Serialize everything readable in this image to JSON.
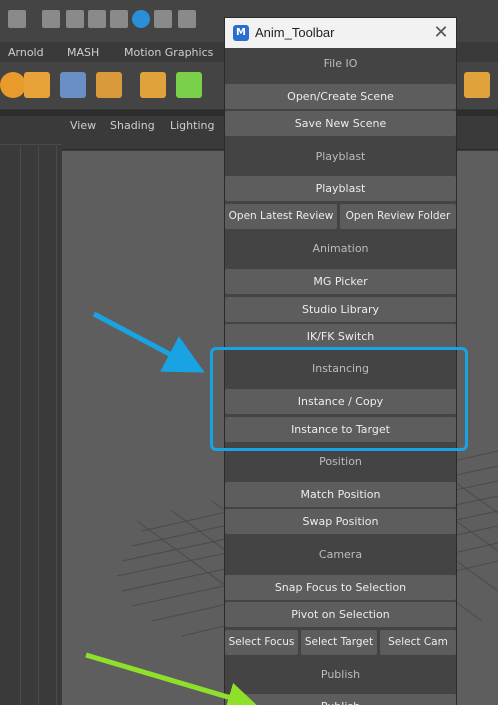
{
  "background": {
    "menubar": [
      "Arnold",
      "MASH",
      "Motion Graphics"
    ],
    "viewport_menu": [
      "View",
      "Shading",
      "Lighting"
    ]
  },
  "window": {
    "title": "Anim_Toolbar",
    "app_icon_letter": "M",
    "close_glyph": "✕",
    "sections": {
      "file_io": {
        "header": "File IO",
        "open_create": "Open/Create Scene",
        "save_new": "Save New Scene"
      },
      "playblast": {
        "header": "Playblast",
        "playblast": "Playblast",
        "open_latest": "Open Latest Review",
        "open_folder": "Open Review Folder"
      },
      "animation": {
        "header": "Animation",
        "mg_picker": "MG Picker",
        "studio_library": "Studio Library",
        "ikfk": "IK/FK Switch"
      },
      "instancing": {
        "header": "Instancing",
        "instance_copy": "Instance / Copy",
        "instance_target": "Instance to Target"
      },
      "position": {
        "header": "Position",
        "match": "Match Position",
        "swap": "Swap Position"
      },
      "camera": {
        "header": "Camera",
        "snap_focus": "Snap Focus to Selection",
        "pivot": "Pivot on Selection",
        "select_focus": "Select Focus",
        "select_target": "Select Target",
        "select_cam": "Select Cam"
      },
      "publish": {
        "header": "Publish",
        "publish": "Publish"
      }
    }
  },
  "colors": {
    "highlight_box": "#1aa3e3",
    "blue_arrow": "#1aa3e3",
    "green_arrow": "#8ee02a"
  }
}
